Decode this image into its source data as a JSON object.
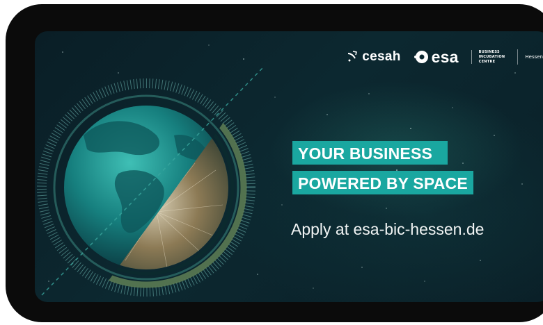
{
  "logos": {
    "cesah": "cesah",
    "esa": "esa",
    "bic_lines": [
      "BUSINESS",
      "INCUBATION",
      "CENTRE"
    ],
    "region": "Hessen"
  },
  "headline": {
    "line1": "YOUR BUSINESS",
    "line2": "POWERED BY SPACE"
  },
  "cta": "Apply at esa-bic-hessen.de",
  "colors": {
    "accent_teal": "#1aa7a0",
    "background": "#0c2830",
    "frame": "#0b0b0b"
  },
  "icons": {
    "cesah": "satellite-icon",
    "esa": "esa-logo-icon",
    "globe": "earth-globe-illustration"
  }
}
